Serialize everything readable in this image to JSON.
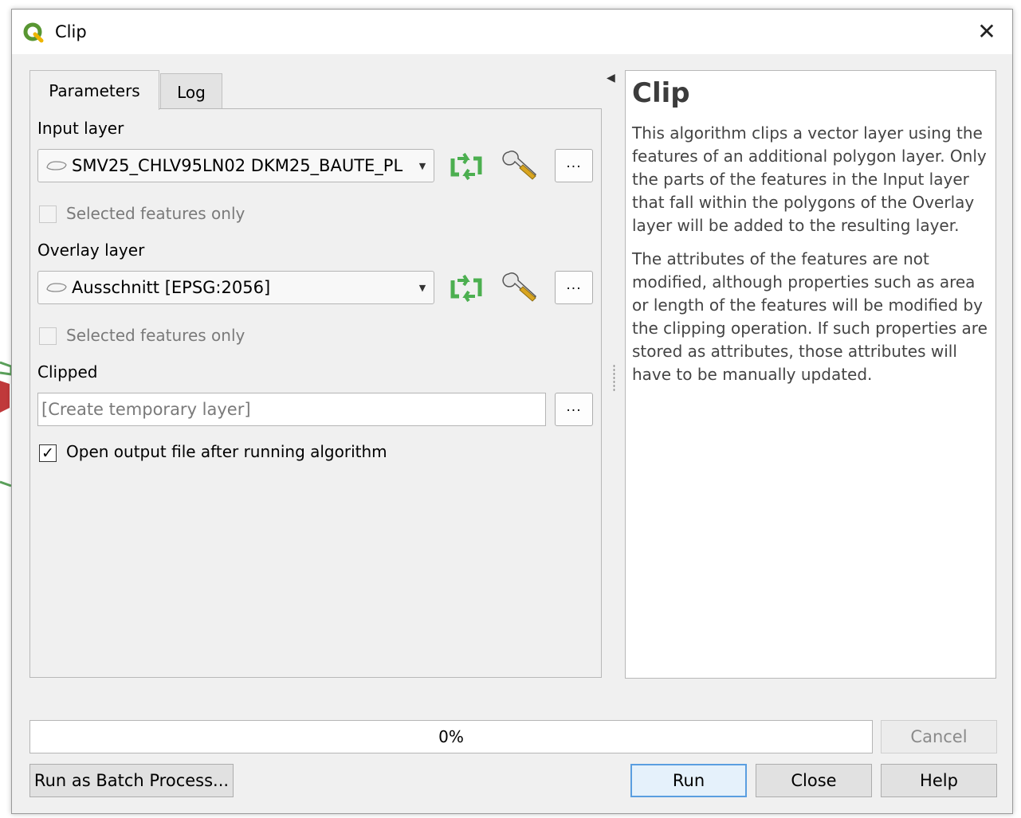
{
  "window": {
    "title": "Clip"
  },
  "tabs": [
    {
      "label": "Parameters",
      "active": true
    },
    {
      "label": "Log",
      "active": false
    }
  ],
  "params": {
    "input_layer": {
      "label": "Input layer",
      "value": "SMV25_CHLV95LN02 DKM25_BAUTE_PL",
      "selected_only": {
        "label": "Selected features only",
        "checked": false
      }
    },
    "overlay_layer": {
      "label": "Overlay layer",
      "value": "Ausschnitt [EPSG:2056]",
      "selected_only": {
        "label": "Selected features only",
        "checked": false
      }
    },
    "clipped": {
      "label": "Clipped",
      "placeholder": "[Create temporary layer]"
    },
    "open_output": {
      "label": "Open output file after running algorithm",
      "checked": true
    },
    "dots_label": "...",
    "check_mark": "✓"
  },
  "help": {
    "title": "Clip",
    "paragraphs": [
      "This algorithm clips a vector layer using the features of an additional polygon layer. Only the parts of the features in the Input layer that fall within the polygons of the Overlay layer will be added to the resulting layer.",
      "The attributes of the features are not modified, although properties such as area or length of the features will be modified by the clipping operation. If such properties are stored as attributes, those attributes will have to be manually updated."
    ]
  },
  "progress": {
    "value": 0,
    "text": "0%"
  },
  "buttons": {
    "cancel": "Cancel",
    "batch": "Run as Batch Process...",
    "run": "Run",
    "close": "Close",
    "help": "Help"
  },
  "icons": {
    "app": "qgis-icon",
    "close": "close-icon",
    "iterate": "iterate-icon",
    "settings": "wrench-icon",
    "polygon": "polygon-layer-icon",
    "dropdown": "chevron-down-icon"
  },
  "colors": {
    "accent": "#5a9ee0",
    "iterate_green": "#4caf50"
  }
}
